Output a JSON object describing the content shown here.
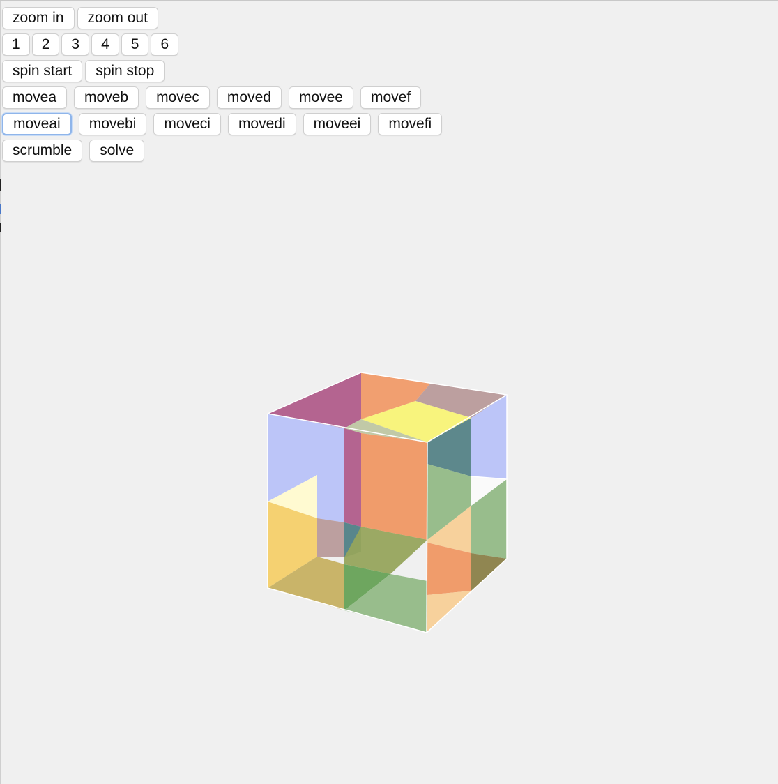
{
  "toolbar": {
    "zoom": [
      "zoom in",
      "zoom out"
    ],
    "faces": [
      "1",
      "2",
      "3",
      "4",
      "5",
      "6"
    ],
    "spin": [
      "spin start",
      "spin stop"
    ],
    "moves": [
      "movea",
      "moveb",
      "movec",
      "moved",
      "movee",
      "movef"
    ],
    "moves_inverse": [
      "moveai",
      "movebi",
      "moveci",
      "movedi",
      "moveei",
      "movefi"
    ],
    "actions": [
      "scrumble",
      "solve"
    ],
    "focused": "moveai"
  },
  "colors": {
    "background": "#f0f0f0",
    "face_blue": "#b8c2f8",
    "face_orange": "#f09a68",
    "face_purple": "#b05c8a",
    "face_yellow": "#f8f47a",
    "face_green": "#96bc8a",
    "face_gold": "#f5d06e",
    "edge": "#ffffff"
  }
}
